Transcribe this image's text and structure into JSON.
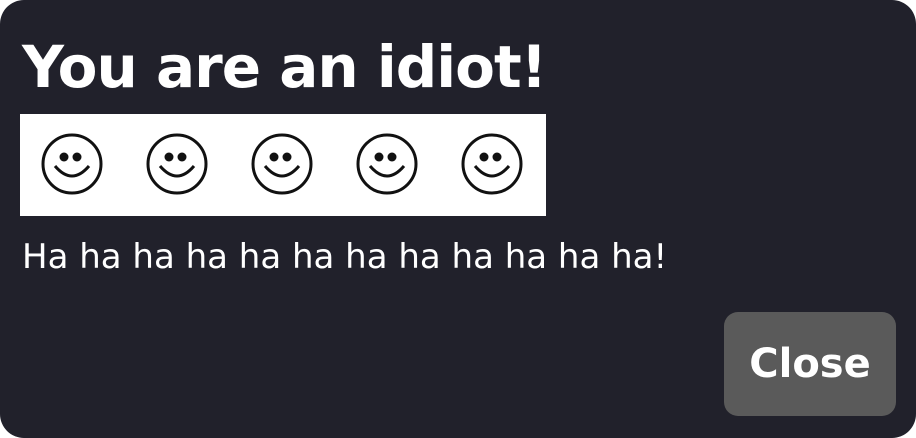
{
  "dialog": {
    "title": "You are an idiot!",
    "smileys": [
      {
        "icon": "smiley-face-icon"
      },
      {
        "icon": "smiley-face-icon"
      },
      {
        "icon": "smiley-face-icon"
      },
      {
        "icon": "smiley-face-icon"
      },
      {
        "icon": "smiley-face-icon"
      }
    ],
    "message": "Ha ha ha ha ha ha ha ha ha ha ha ha!",
    "close_label": "Close"
  },
  "colors": {
    "background": "#21212b",
    "button": "#5a5a5a",
    "text": "#ffffff",
    "smiley_panel": "#ffffff"
  }
}
